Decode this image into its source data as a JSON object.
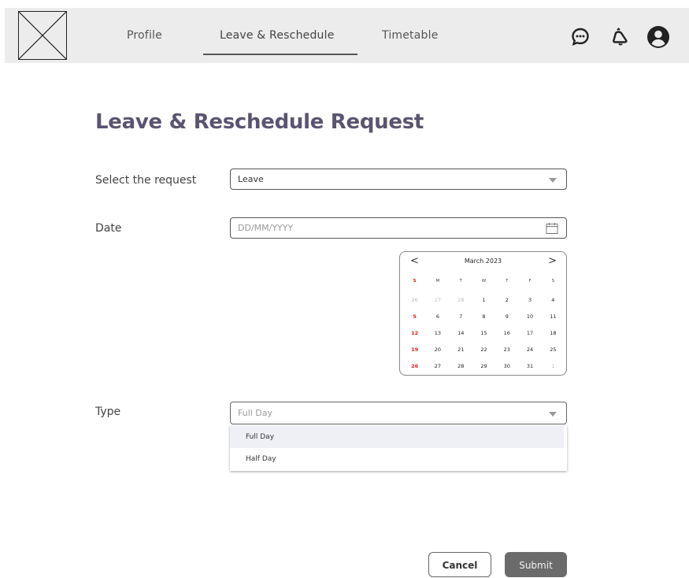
{
  "nav": {
    "items": [
      {
        "label": "Profile"
      },
      {
        "label": "Leave & Reschedule",
        "active": true
      },
      {
        "label": "Timetable"
      }
    ],
    "icons": [
      "chat-icon",
      "bell-icon",
      "user-icon"
    ]
  },
  "page": {
    "title": "Leave & Reschedule Request"
  },
  "form": {
    "request": {
      "label": "Select the request",
      "value": "Leave"
    },
    "date": {
      "label": "Date",
      "placeholder": "DD/MM/YYYY"
    },
    "type": {
      "label": "Type",
      "placeholder": "Full Day",
      "options": [
        "Full Day",
        "Half Day"
      ]
    }
  },
  "calendar": {
    "month": "March 2023",
    "prev": "<",
    "next": ">",
    "weekdays": [
      "S",
      "M",
      "T",
      "W",
      "T",
      "F",
      "S"
    ],
    "weeks": [
      [
        "26",
        "27",
        "28",
        "1",
        "2",
        "3",
        "4"
      ],
      [
        "5",
        "6",
        "7",
        "8",
        "9",
        "10",
        "11"
      ],
      [
        "12",
        "13",
        "14",
        "15",
        "16",
        "17",
        "18"
      ],
      [
        "19",
        "20",
        "21",
        "22",
        "23",
        "24",
        "25"
      ],
      [
        "26",
        "27",
        "28",
        "29",
        "30",
        "31",
        "1"
      ]
    ]
  },
  "buttons": {
    "cancel": "Cancel",
    "submit": "Submit"
  },
  "colors": {
    "title": "#5b5470",
    "accent_sunday": "#e02020",
    "submit_bg": "#6b6b6b",
    "header_bg": "#ececec"
  }
}
